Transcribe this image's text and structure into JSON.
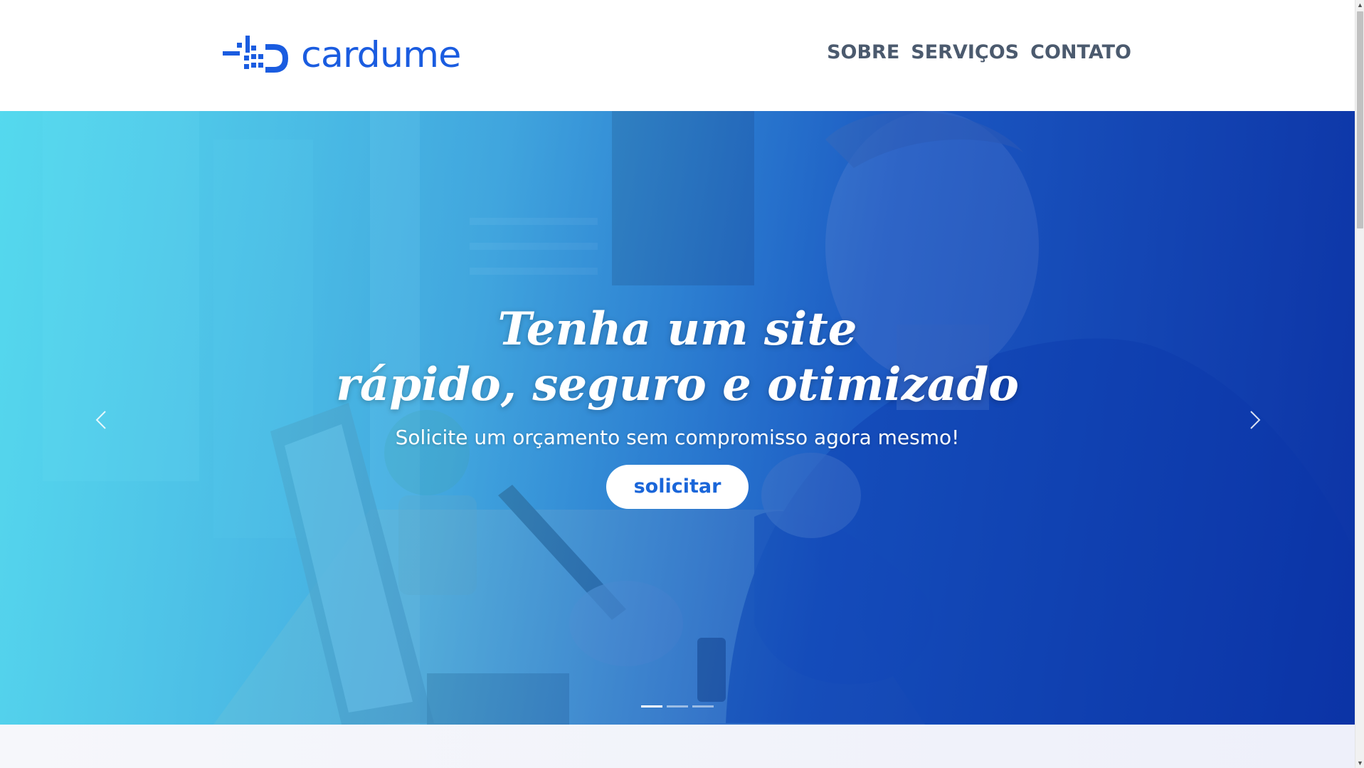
{
  "header": {
    "logo_text": "cardume",
    "nav": [
      {
        "label": "SOBRE"
      },
      {
        "label": "SERVIÇOS"
      },
      {
        "label": "CONTATO"
      }
    ]
  },
  "hero": {
    "title_line1": "Tenha um site",
    "title_line2": "rápido, seguro e otimizado",
    "subtitle": "Solicite um orçamento sem compromisso agora mesmo!",
    "cta_label": "solicitar",
    "prev_icon": "chevron-left-icon",
    "next_icon": "chevron-right-icon",
    "slides_count": 3,
    "active_slide": 1
  },
  "colors": {
    "brand": "#1a5ce0",
    "nav_text": "#4b5a6e",
    "cta_text": "#1a66d9",
    "overlay_start": "#50dcf0",
    "overlay_end": "#0a32aa"
  }
}
